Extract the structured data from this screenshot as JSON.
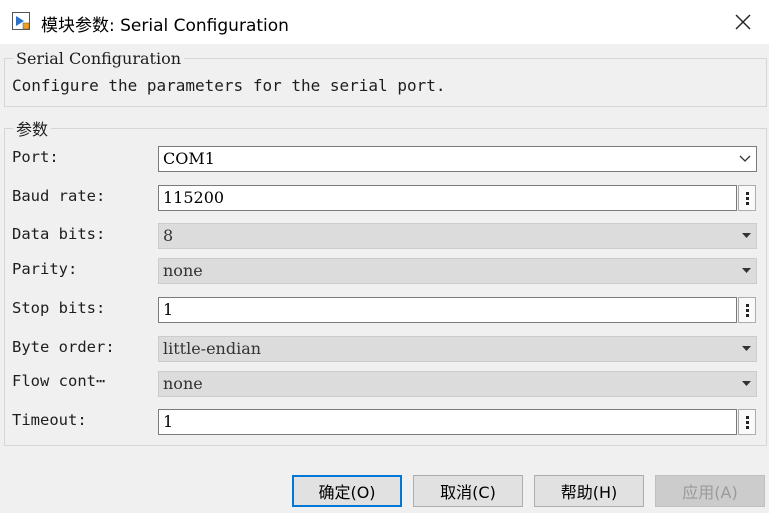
{
  "window": {
    "title": "模块参数: Serial Configuration",
    "icon": "simulink-block-icon",
    "close_icon": "close-icon"
  },
  "description_group": {
    "legend": "Serial Configuration",
    "text": "Configure the parameters for the serial port."
  },
  "params_group": {
    "legend": "参数",
    "fields": [
      {
        "label": "Port:",
        "value": "COM1",
        "control": "dropdown",
        "enabled": true
      },
      {
        "label": "Baud rate:",
        "value": "115200",
        "control": "edit"
      },
      {
        "label": "Data bits:",
        "value": "8",
        "control": "dropdown",
        "enabled": false
      },
      {
        "label": "Parity:",
        "value": "none",
        "control": "dropdown",
        "enabled": false
      },
      {
        "label": "Stop bits:",
        "value": "1",
        "control": "edit"
      },
      {
        "label": "Byte order:",
        "value": "little-endian",
        "control": "dropdown",
        "enabled": false
      },
      {
        "label": "Flow cont⋯",
        "value": "none",
        "control": "dropdown",
        "enabled": false
      },
      {
        "label": "Timeout:",
        "value": "1",
        "control": "edit"
      }
    ]
  },
  "buttons": {
    "ok": "确定(O)",
    "cancel": "取消(C)",
    "help": "帮助(H)",
    "apply": "应用(A)"
  },
  "colors": {
    "accent": "#0078d7",
    "window_bg": "#f0f0f0",
    "titlebar_bg": "#ffffff",
    "disabled_field_bg": "#dcdcdc"
  }
}
